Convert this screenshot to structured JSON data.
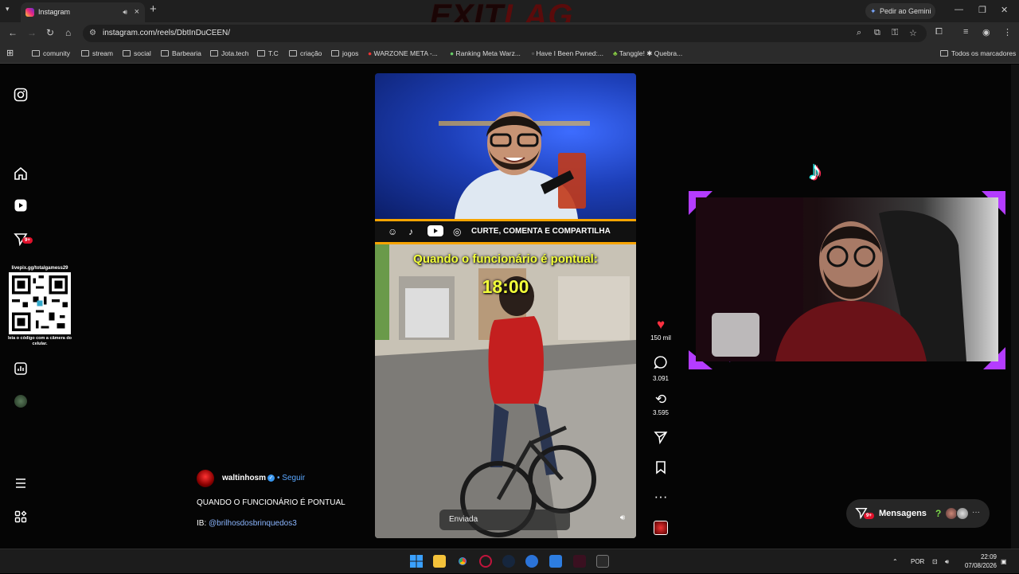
{
  "browser": {
    "tab_title": "Instagram",
    "new_tab": "+",
    "url": "instagram.com/reels/DbtInDuCEEN/",
    "gemini_label": "Pedir ao Gemini",
    "bookmarks": [
      "comunity",
      "stream",
      "social",
      "Barbearia",
      "Jota.tech",
      "T.C",
      "criação",
      "jogos",
      "WARZONE META -...",
      "Ranking Meta Warz...",
      "Have I Been Pwned:...",
      "Tanggle! ✱ Quebra..."
    ],
    "all_bookmarks": "Todos os marcadores"
  },
  "overlay": {
    "brand_a": "EXIT",
    "brand_b": "LAG",
    "qr_label": "livepix.gg/totalgamess29",
    "qr_caption": "leia o código com a câmera do celular."
  },
  "sidebar": {
    "notifications_badge": "9+"
  },
  "reel": {
    "banner_text": "CURTE, COMENTA E COMPARTILHA",
    "caption_line1": "Quando o funcionário é pontual:",
    "caption_line2": "18:00",
    "sent_label": "Enviada",
    "likes": "150 mil",
    "comments": "3.091",
    "reposts": "3.595"
  },
  "author": {
    "username": "waltinhosm",
    "follow": "• Seguir",
    "description": "QUANDO O FUNCIONÁRIO É PONTUAL",
    "ib_prefix": "IB: ",
    "ib_handle": "@brilhosdosbrinquedos3"
  },
  "messages": {
    "label": "Mensagens",
    "badge": "9+",
    "question": "?",
    "more": "···"
  },
  "taskbar": {
    "language": "POR",
    "time": "22:09",
    "date": "07/08/2026"
  }
}
